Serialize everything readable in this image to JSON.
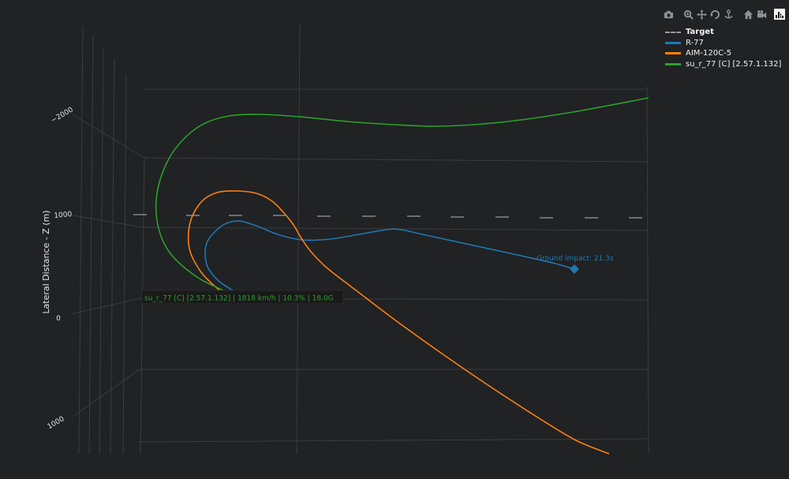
{
  "toolbar": {
    "buttons": [
      "camera-icon",
      "zoom-icon",
      "pan-icon",
      "orbit-icon",
      "turntable-icon",
      "reset-home-icon",
      "reset-view-icon"
    ],
    "logo": "plotly-logo-icon"
  },
  "chart_data": {
    "type": "line",
    "ylabel": "Lateral Distance - Z (m)",
    "z_ticks": [
      {
        "label": "−2000",
        "value": -2000
      },
      {
        "label": "1000",
        "value": 1000
      },
      {
        "label": "0",
        "value": 0
      },
      {
        "label": "1000",
        "value": 1000
      }
    ],
    "series": [
      {
        "name": "Target",
        "color": "#9a9a9a",
        "dash": true,
        "points": [
          [
            169,
            272
          ],
          [
            236,
            273
          ],
          [
            290,
            273
          ],
          [
            346,
            273
          ],
          [
            402,
            274
          ],
          [
            459,
            274
          ],
          [
            516,
            274
          ],
          [
            571,
            275
          ],
          [
            628,
            275
          ],
          [
            684,
            276
          ],
          [
            741,
            276
          ],
          [
            797,
            276
          ]
        ]
      },
      {
        "name": "R-77",
        "color": "#1f77b4",
        "points": [
          [
            295,
            368
          ],
          [
            276,
            355
          ],
          [
            262,
            335
          ],
          [
            262,
            308
          ],
          [
            280,
            287
          ],
          [
            300,
            280
          ],
          [
            322,
            285
          ],
          [
            352,
            297
          ],
          [
            383,
            304
          ],
          [
            418,
            303
          ],
          [
            455,
            297
          ],
          [
            490,
            291
          ],
          [
            508,
            291
          ],
          [
            540,
            298
          ],
          [
            600,
            311
          ],
          [
            660,
            324
          ],
          [
            700,
            333
          ],
          [
            728,
            341
          ]
        ]
      },
      {
        "name": "AIM-120C-5",
        "color": "#ff7f0e",
        "points": [
          [
            278,
            368
          ],
          [
            255,
            345
          ],
          [
            240,
            315
          ],
          [
            241,
            282
          ],
          [
            255,
            256
          ],
          [
            275,
            244
          ],
          [
            300,
            242
          ],
          [
            325,
            245
          ],
          [
            345,
            255
          ],
          [
            360,
            270
          ],
          [
            372,
            285
          ],
          [
            382,
            302
          ],
          [
            395,
            320
          ],
          [
            415,
            340
          ],
          [
            450,
            367
          ],
          [
            500,
            405
          ],
          [
            560,
            448
          ],
          [
            620,
            489
          ],
          [
            680,
            528
          ],
          [
            730,
            558
          ],
          [
            772,
            575
          ]
        ]
      },
      {
        "name": "su_r_77 [C] [2.57.1.132]",
        "color": "#2ca02c",
        "points": [
          [
            283,
            368
          ],
          [
            248,
            350
          ],
          [
            215,
            320
          ],
          [
            200,
            285
          ],
          [
            199,
            245
          ],
          [
            212,
            205
          ],
          [
            232,
            177
          ],
          [
            258,
            157
          ],
          [
            290,
            147
          ],
          [
            330,
            145
          ],
          [
            380,
            148
          ],
          [
            440,
            154
          ],
          [
            500,
            158
          ],
          [
            550,
            160
          ],
          [
            600,
            158
          ],
          [
            660,
            152
          ],
          [
            720,
            143
          ],
          [
            770,
            134
          ],
          [
            822,
            124
          ]
        ]
      }
    ],
    "markers": [
      {
        "series": "R-77",
        "x": 728,
        "y": 341,
        "symbol": "diamond"
      }
    ],
    "annotations": [
      {
        "text": "Ground impact: 21.3s",
        "color": "#1f77b4"
      }
    ],
    "tooltip": {
      "text": "su_r_77 [C] [2.57.1.132] | 1818 km/h | 10.3% | 18.0G",
      "color": "#2ca02c"
    },
    "legend_position": "top-right",
    "grid": true
  }
}
